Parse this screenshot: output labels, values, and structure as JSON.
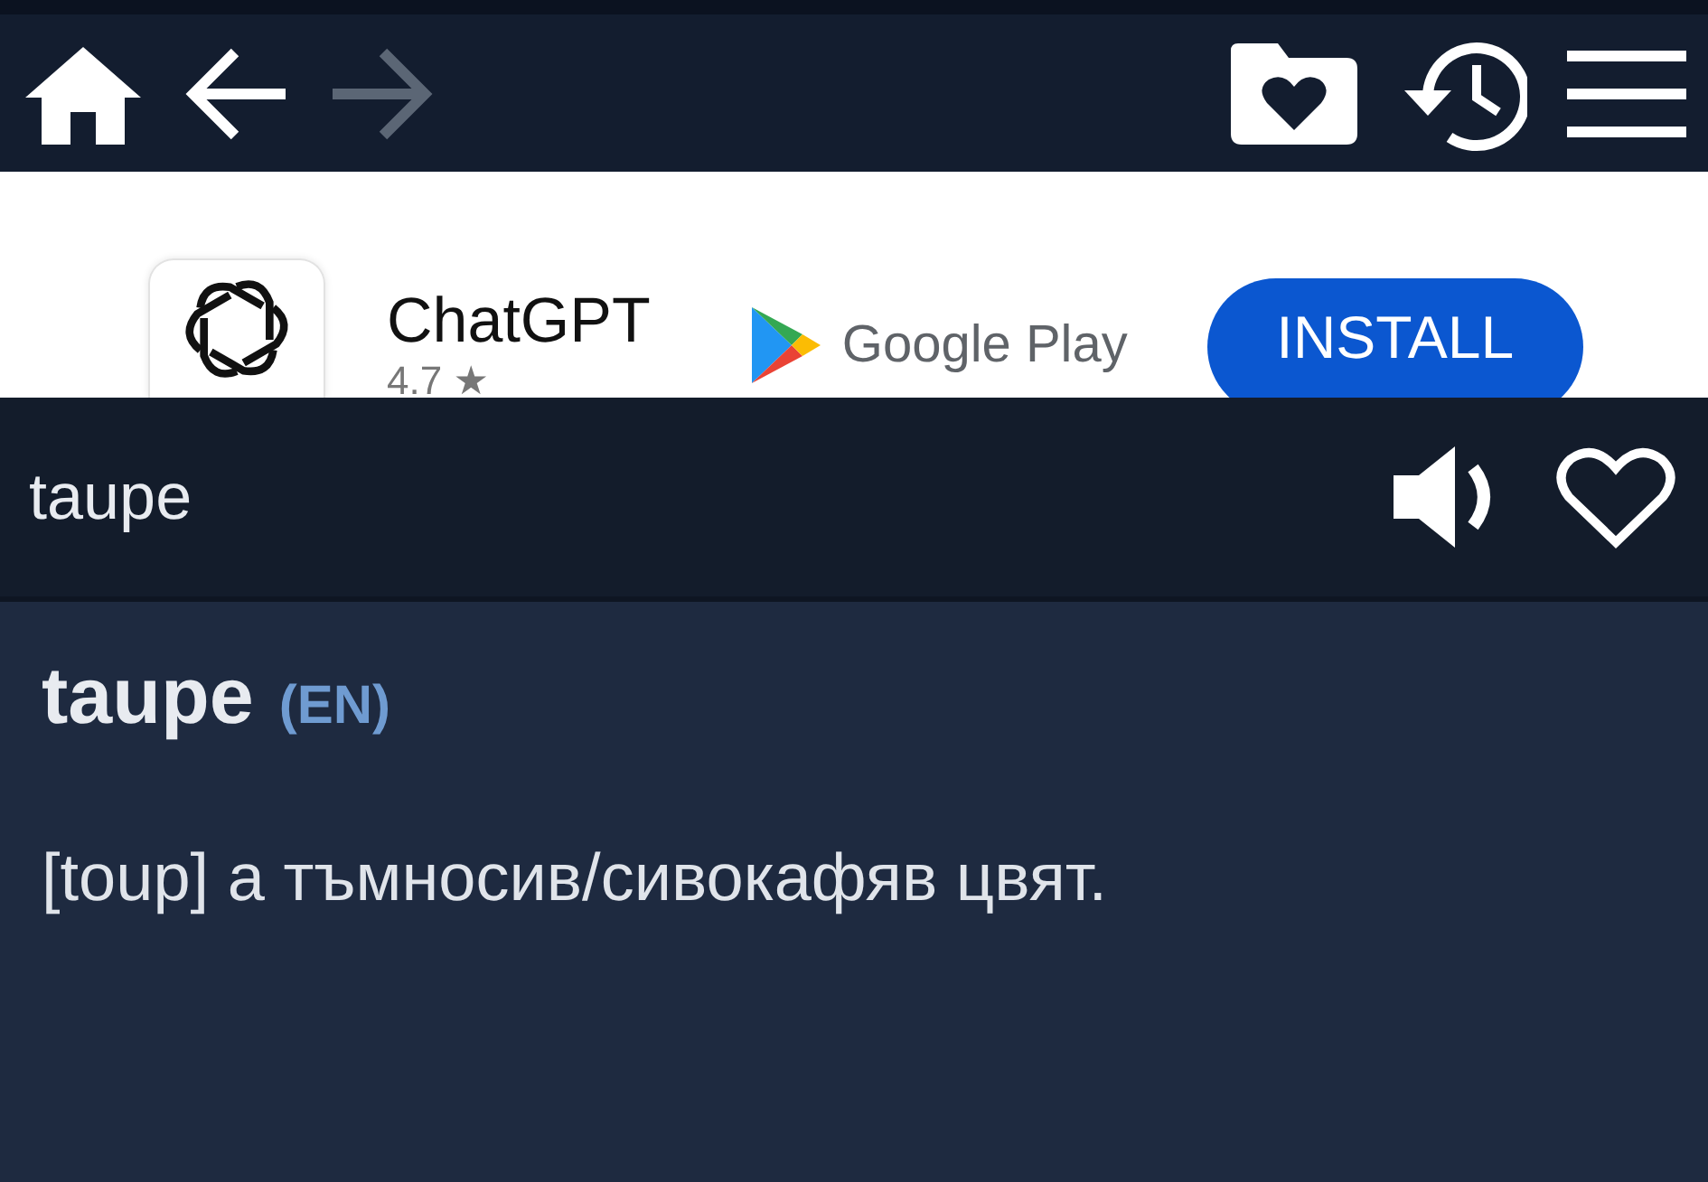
{
  "toolbar": {
    "back_disabled": false,
    "forward_disabled": true
  },
  "ad": {
    "app_name": "ChatGPT",
    "rating": "4.7 ★",
    "store": "Google Play",
    "button": "INSTALL"
  },
  "search": {
    "value": "taupe",
    "favorite": false
  },
  "entry": {
    "word": "taupe",
    "language": "(EN)",
    "definition": "[toup] а тъмносив/сивокафяв цвят."
  }
}
